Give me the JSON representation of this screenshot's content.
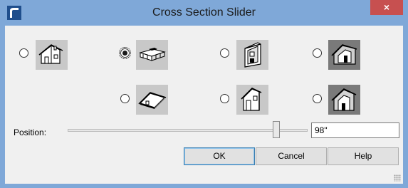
{
  "window": {
    "title": "Cross Section Slider",
    "app_icon": "app-logo-icon",
    "close_glyph": "×"
  },
  "views": [
    {
      "name": "view-exterior-house",
      "icon": "house-outline-icon",
      "checked": false
    },
    {
      "name": "view-plan-cut",
      "icon": "plan-cut-icon",
      "checked": true
    },
    {
      "name": "view-front-cut",
      "icon": "front-section-icon",
      "checked": false
    },
    {
      "name": "view-perspective-cut",
      "icon": "perspective-section-icon",
      "checked": false
    },
    {
      "name": "view-roof-cut",
      "icon": "roof-section-icon",
      "checked": false
    },
    {
      "name": "view-side-cut",
      "icon": "side-section-icon",
      "checked": false
    },
    {
      "name": "view-back-cut",
      "icon": "back-section-icon",
      "checked": false
    }
  ],
  "position": {
    "label": "Position:",
    "value": "98\"",
    "slider_level": 0.87
  },
  "buttons": {
    "ok": "OK",
    "cancel": "Cancel",
    "help": "Help"
  },
  "colors": {
    "titlebar": "#7fa8d8",
    "close": "#c75050",
    "thumb_bg": "#c8c8c8",
    "dialog_bg": "#f0f0f0"
  }
}
